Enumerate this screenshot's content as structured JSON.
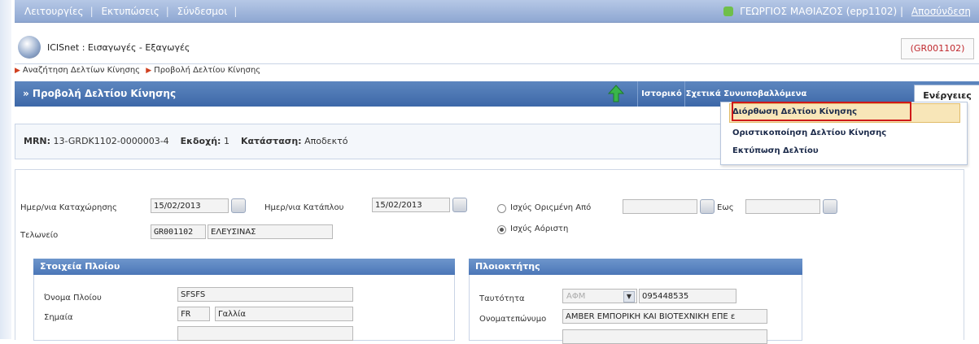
{
  "topbar": {
    "menu": [
      "Λειτουργίες",
      "Εκτυπώσεις",
      "Σύνδεσμοι"
    ],
    "user": "ΓΕΩΡΓΙΟΣ ΜΑΘΙΑΖΟΣ (epp1102)",
    "logout": "Αποσύνδεση"
  },
  "app": {
    "title": "ICISnet : Εισαγωγές - Εξαγωγές",
    "code": "(GR001102)"
  },
  "breadcrumb": {
    "items": [
      "Αναζήτηση Δελτίων Κίνησης",
      "Προβολή Δελτίου Κίνησης"
    ]
  },
  "panel": {
    "title": "» Προβολή Δελτίου Κίνησης",
    "tab_history": "Ιστορικό",
    "tab_docs": "Σχετικά Συνυποβαλλόμενα Αρχεία",
    "tab_actions": "Ενέργειες"
  },
  "actions_menu": [
    "Διόρθωση Δελτίου Κίνησης",
    "Οριστικοποίηση Δελτίου Κίνησης",
    "Εκτύπωση Δελτίου"
  ],
  "info": {
    "mrn_label": "MRN:",
    "mrn": "13-GRDK1102-0000003-4",
    "issue_label": "Εκδοχή:",
    "issue": "1",
    "status_label": "Κατάσταση:",
    "status": "Αποδεκτό"
  },
  "form": {
    "reg_date_label": "Ημερ/νια Καταχώρησης",
    "reg_date": "15/02/2013",
    "berth_date_label": "Ημερ/νια Κατάπλου",
    "berth_date": "15/02/2013",
    "validity_from_label": "Ισχύς Οριςμένη Από",
    "validity_to_label": "Εως",
    "validity_indef_label": "Ισχύς Αόριστη",
    "office_label": "Τελωνείο",
    "office_code": "GR001102",
    "office_name": "ΕΛΕΥΣΙΝΑΣ"
  },
  "ship": {
    "title": "Στοιχεία Πλοίου",
    "name_label": "Όνομα Πλοίου",
    "name": "SFSFS",
    "flag_label": "Σημαία",
    "flag_code": "FR",
    "flag_name": "Γαλλία"
  },
  "owner": {
    "title": "Πλοιοκτήτης",
    "id_label": "Ταυτότητα",
    "id_type": "ΑΦΜ",
    "id_value": "095448535",
    "fullname_label": "Ονοματεπώνυμο",
    "fullname": "AMBER ΕΜΠΟΡΙΚΗ ΚΑΙ ΒΙΟΤΕΧΝΙΚΗ ΕΠΕ ε"
  }
}
